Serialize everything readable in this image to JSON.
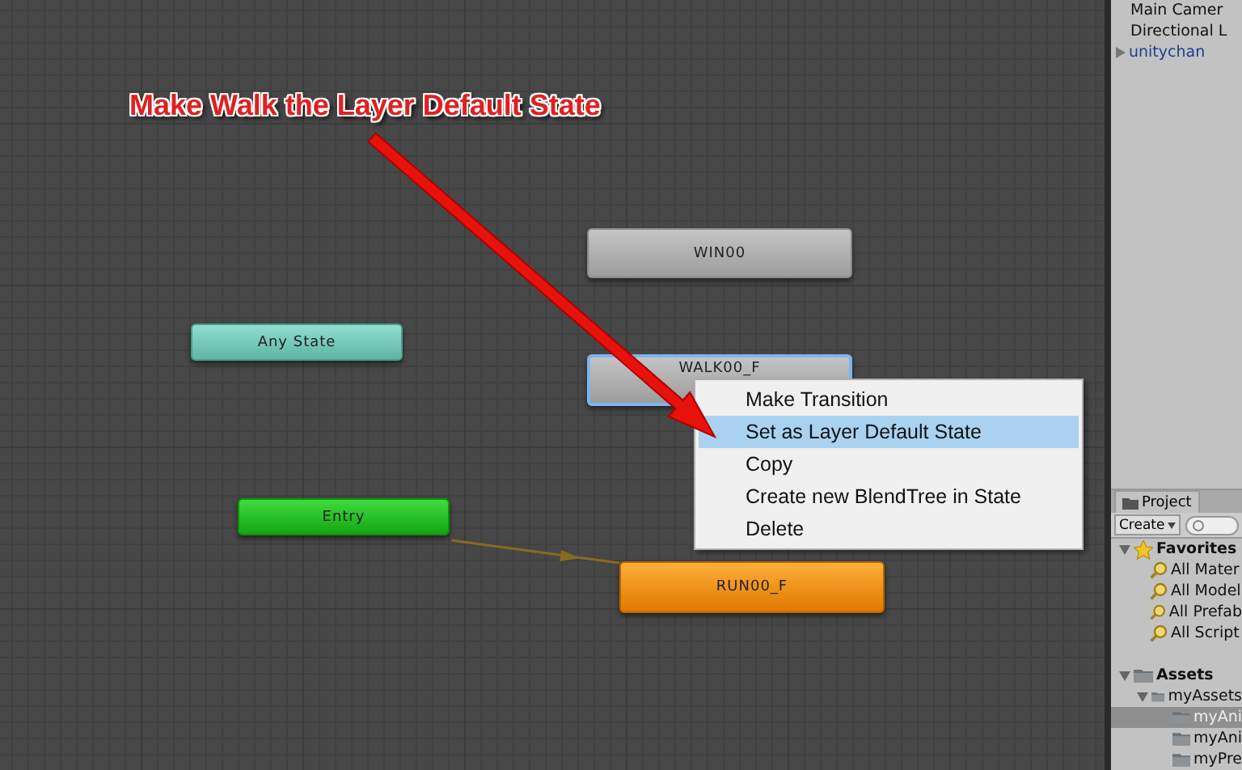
{
  "annotation": {
    "text": "Make Walk the Layer Default State"
  },
  "graph": {
    "nodes": [
      {
        "label": "WIN00",
        "kind": "state",
        "selected": false
      },
      {
        "label": "Any State",
        "kind": "any_state",
        "selected": false
      },
      {
        "label": "WALK00_F",
        "kind": "state",
        "selected": true
      },
      {
        "label": "Entry",
        "kind": "entry",
        "selected": false
      },
      {
        "label": "RUN00_F",
        "kind": "default_state",
        "selected": false
      }
    ]
  },
  "context_menu": {
    "items": [
      {
        "label": "Make Transition",
        "selected": false
      },
      {
        "label": "Set as Layer Default State",
        "selected": true
      },
      {
        "label": "Copy",
        "selected": false
      },
      {
        "label": "Create new BlendTree in State",
        "selected": false
      },
      {
        "label": "Delete",
        "selected": false
      }
    ]
  },
  "hierarchy": {
    "items": [
      {
        "label": "Main Camer",
        "kind": "object"
      },
      {
        "label": "Directional L",
        "kind": "object"
      },
      {
        "label": "unitychan",
        "kind": "prefab"
      }
    ]
  },
  "project": {
    "tab": "Project",
    "create_button": "Create",
    "favorites": {
      "label": "Favorites",
      "expanded": true,
      "items": [
        "All Mater",
        "All Model",
        "All Prefab",
        "All Script"
      ]
    },
    "assets": {
      "label": "Assets",
      "expanded": true,
      "selected": false,
      "children": [
        {
          "label": "myAssets",
          "expanded": true,
          "selected": false,
          "children": [
            {
              "label": "myAni",
              "selected": true
            },
            {
              "label": "myAni",
              "selected": false
            },
            {
              "label": "myPre",
              "selected": false
            }
          ]
        }
      ]
    }
  }
}
